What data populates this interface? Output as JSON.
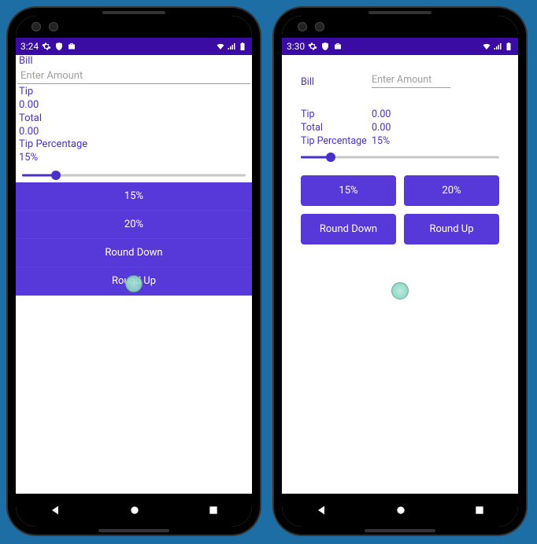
{
  "phone1": {
    "status": {
      "time": "3:24"
    },
    "labels": {
      "bill": "Bill",
      "amount_placeholder": "Enter Amount",
      "tip": "Tip",
      "tip_value": "0.00",
      "total": "Total",
      "total_value": "0.00",
      "tip_pct_label": "Tip Percentage",
      "tip_pct_value": "15%"
    },
    "buttons": {
      "b15": "15%",
      "b20": "20%",
      "round_down": "Round Down",
      "round_up": "Round Up"
    },
    "slider": {
      "percent": 15,
      "min": 0,
      "max": 100
    }
  },
  "phone2": {
    "status": {
      "time": "3:30"
    },
    "labels": {
      "bill": "Bill",
      "amount_placeholder": "Enter Amount",
      "tip": "Tip",
      "tip_value": "0.00",
      "total": "Total",
      "total_value": "0.00",
      "tip_pct_label": "Tip Percentage",
      "tip_pct_value": "15%"
    },
    "buttons": {
      "b15": "15%",
      "b20": "20%",
      "round_down": "Round Down",
      "round_up": "Round Up"
    },
    "slider": {
      "percent": 15,
      "min": 0,
      "max": 100
    }
  },
  "colors": {
    "accent": "#4b2fc9",
    "button": "#5639d8"
  }
}
